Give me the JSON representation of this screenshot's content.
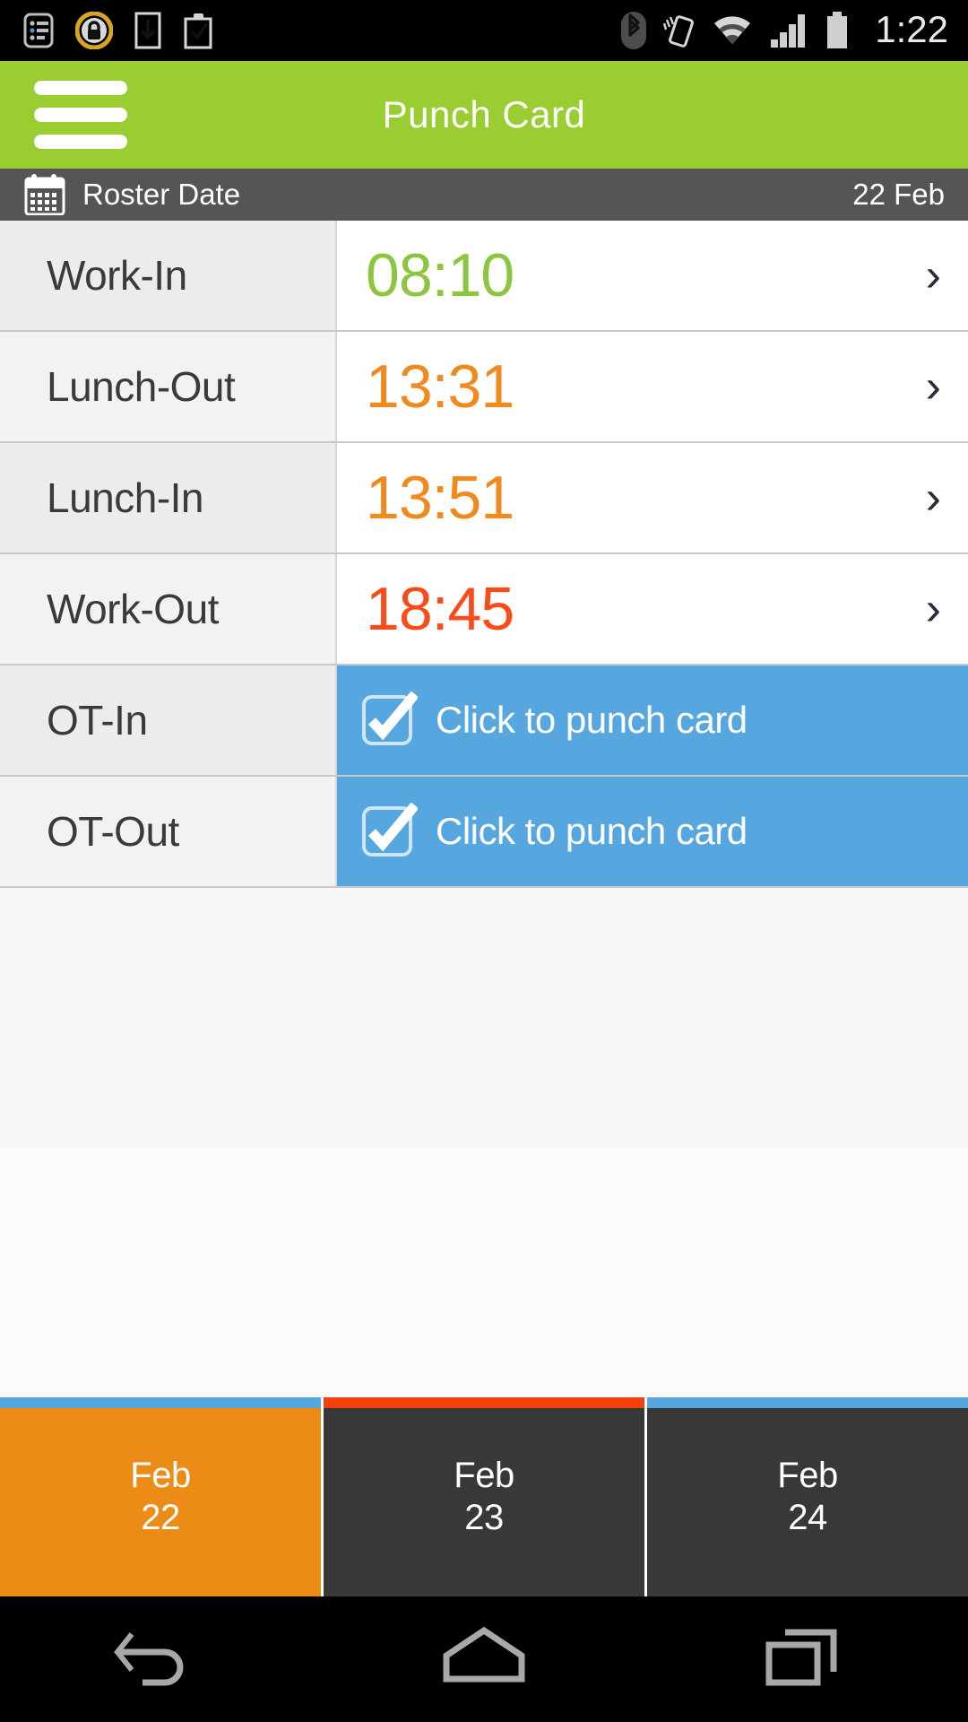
{
  "statusbar": {
    "time": "1:22",
    "left_icons": [
      "list-notification-icon",
      "lock-icon",
      "download-icon",
      "clipboard-check-icon"
    ],
    "right_icons": [
      "bluetooth-icon",
      "vibrate-icon",
      "wifi-icon",
      "cellular-signal-icon",
      "battery-icon"
    ],
    "lock_color": "#D9A520"
  },
  "appbar": {
    "title": "Punch Card",
    "menu_icon": "hamburger-menu-icon",
    "bg_color": "#9ACD32"
  },
  "roster": {
    "icon": "calendar-icon",
    "label": "Roster Date",
    "date": "22 Feb",
    "bg_color": "#555555"
  },
  "punch_rows": [
    {
      "label": "Work-In",
      "value": "08:10",
      "color": "#8CC63E",
      "type": "time",
      "chevron": "›"
    },
    {
      "label": "Lunch-Out",
      "value": "13:31",
      "color": "#F08A1E",
      "type": "time",
      "chevron": "›"
    },
    {
      "label": "Lunch-In",
      "value": "13:51",
      "color": "#F08A1E",
      "type": "time",
      "chevron": "›"
    },
    {
      "label": "Work-Out",
      "value": "18:45",
      "color": "#FA4B19",
      "type": "time",
      "chevron": "›"
    },
    {
      "label": "OT-In",
      "value": "Click to punch card",
      "color": "#FFFFFF",
      "type": "punch",
      "icon": "checkbox-checked-icon",
      "bg": "#56A7E0"
    },
    {
      "label": "OT-Out",
      "value": "Click to punch card",
      "color": "#FFFFFF",
      "type": "punch",
      "icon": "checkbox-checked-icon",
      "bg": "#56A7E0"
    }
  ],
  "date_tabs": [
    {
      "month": "Feb",
      "day": "22",
      "accent": "#56A7E0",
      "bg": "#ED8B17",
      "active": true
    },
    {
      "month": "Feb",
      "day": "23",
      "accent": "#F4410B",
      "bg": "#383838",
      "active": false
    },
    {
      "month": "Feb",
      "day": "24",
      "accent": "#56A7E0",
      "bg": "#383838",
      "active": false
    }
  ],
  "navbar": {
    "back": "back-icon",
    "home": "home-icon",
    "recents": "recents-icon"
  }
}
